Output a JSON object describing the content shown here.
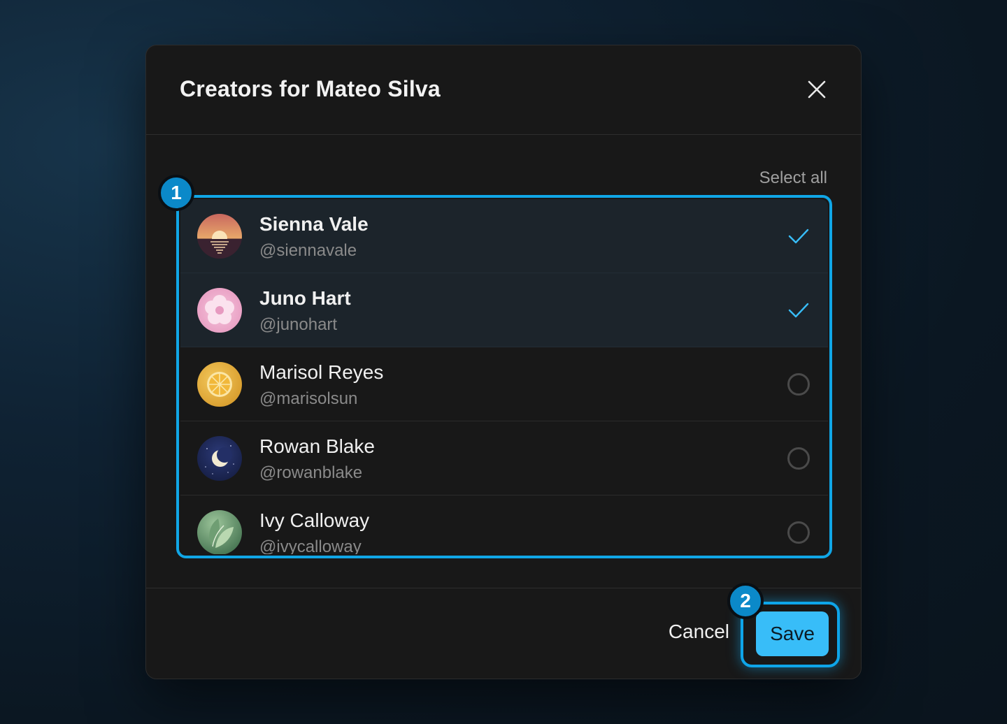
{
  "dialog": {
    "title": "Creators for Mateo Silva",
    "close_icon": "close-icon",
    "select_all_label": "Select all",
    "cancel_label": "Cancel",
    "save_label": "Save"
  },
  "creators": [
    {
      "name": "Sienna Vale",
      "handle": "@siennavale",
      "selected": true,
      "avatar": "sunset-avatar"
    },
    {
      "name": "Juno Hart",
      "handle": "@junohart",
      "selected": true,
      "avatar": "flower-avatar"
    },
    {
      "name": "Marisol Reyes",
      "handle": "@marisolsun",
      "selected": false,
      "avatar": "citrus-avatar"
    },
    {
      "name": "Rowan Blake",
      "handle": "@rowanblake",
      "selected": false,
      "avatar": "moon-avatar"
    },
    {
      "name": "Ivy Calloway",
      "handle": "@ivycalloway",
      "selected": false,
      "avatar": "leaf-avatar"
    }
  ],
  "annotations": {
    "badge_1": "1",
    "badge_2": "2"
  },
  "colors": {
    "accent": "#10a6e6",
    "save_bg": "#38bdf8",
    "check": "#38bdf8",
    "selected_row_bg": "#1c242b"
  }
}
